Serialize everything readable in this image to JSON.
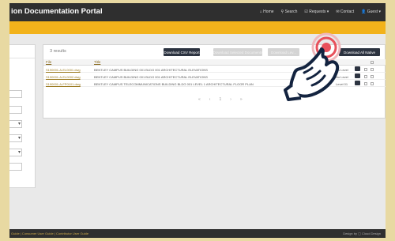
{
  "header": {
    "title": "ion Documentation Portal",
    "nav": [
      "⌂ Home",
      "⚲ Search",
      "☑ Requests ▾",
      "✉ Contact",
      "👤 Guest ▾"
    ]
  },
  "results": {
    "count_text": "3 results"
  },
  "toolbar": {
    "download_csv": "Download CSV Report",
    "disabled_1": "Download Selected Documents",
    "disabled_2": "Download Lev...",
    "download_all": "Download All Native"
  },
  "table": {
    "columns": [
      "File",
      "Title"
    ],
    "rows": [
      {
        "file": "S190001-A-EL0001.dwg",
        "title": "BENTLEY CAMPUS BUILDING 001 BLDG 001 ARCHITECTURAL ELEVATIONS",
        "level": "No Level"
      },
      {
        "file": "S190001-A-EL0002.dwg",
        "title": "BENTLEY CAMPUS BUILDING 001 BLDG 001 ARCHITECTURAL ELEVATIONS",
        "level": "No Level"
      },
      {
        "file": "S190001-A-FP0101.dwg",
        "title": "BENTLEY CAMPUS TELECOMMUNICATIONS BUILDING BLDG 001 LEVEL 1 ARCHITECTURAL FLOOR PLAN",
        "level": "Level 01"
      }
    ]
  },
  "pagination": [
    "«",
    "‹",
    "1",
    "›",
    "»"
  ],
  "footer": {
    "links": "Guide | Consumer User Guide | Contributor User Guide",
    "credit": "Design by ▢ Cloud Design"
  },
  "colors": {
    "accent": "#f2b21b",
    "dark": "#2f2f2f",
    "button": "#2c3340",
    "hand_ring": "#e8505b"
  }
}
